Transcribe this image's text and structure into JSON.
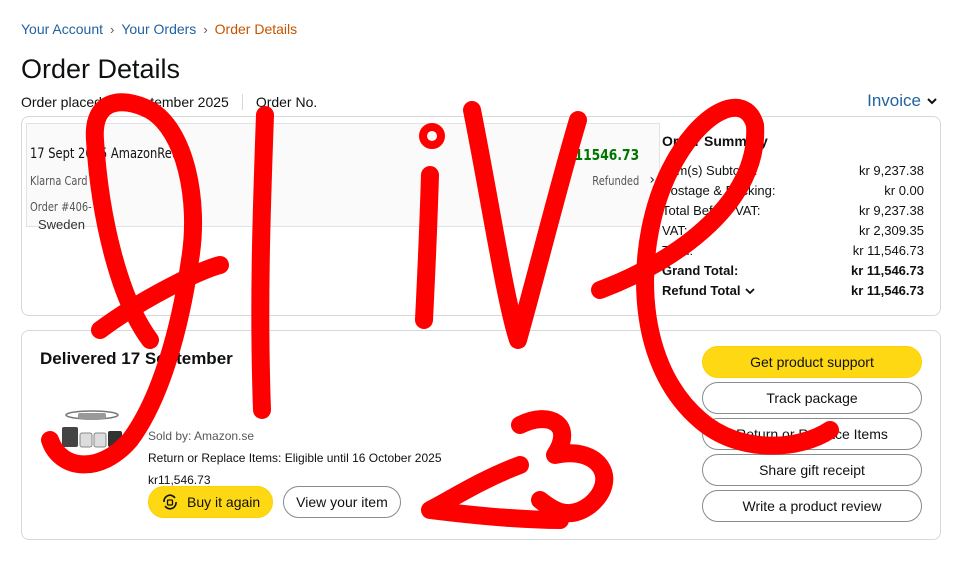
{
  "breadcrumb": {
    "items": [
      "Your Account",
      "Your Orders"
    ],
    "current": "Order Details"
  },
  "page": {
    "title": "Order Details",
    "order_placed": "Order placed 15 September 2025",
    "order_no_label": "Order No.",
    "invoice_label": "Invoice"
  },
  "receipt": {
    "title": "17 Sept 2025 AmazonRetail",
    "card": "Klarna Card",
    "order": "Order #406-",
    "amount": "kr11546.73",
    "status": "Refunded",
    "under_text": "Sweden"
  },
  "summary": {
    "heading": "Order Summary",
    "rows": [
      {
        "label": "Item(s) Subtotal:",
        "value": "kr 9,237.38"
      },
      {
        "label": "Postage & Packing:",
        "value": "kr 0.00"
      },
      {
        "label": "Total Before VAT:",
        "value": "kr 9,237.38"
      },
      {
        "label": "VAT:",
        "value": "kr 2,309.35"
      },
      {
        "label": "Total:",
        "value": "kr 11,546.73"
      },
      {
        "label": "Grand Total:",
        "value": "kr 11,546.73"
      },
      {
        "label": "Refund Total",
        "value": "kr 11,546.73"
      }
    ]
  },
  "shipment": {
    "status": "Delivered 17 September",
    "sold_by": "Sold by: Amazon.se",
    "return_info": "Return or Replace Items: Eligible until 16 October 2025",
    "price": "kr11,546.73",
    "buy_again": "Buy it again",
    "view_item": "View your item"
  },
  "actions": [
    "Get product support",
    "Track package",
    "Return or Replace Items",
    "Share gift receipt",
    "Write a product review"
  ],
  "colors": {
    "link": "#2162a1",
    "current_crumb": "#c45500",
    "primary_button": "#ffd814",
    "refund_green": "#007600",
    "scribble_red": "#ff0000"
  }
}
